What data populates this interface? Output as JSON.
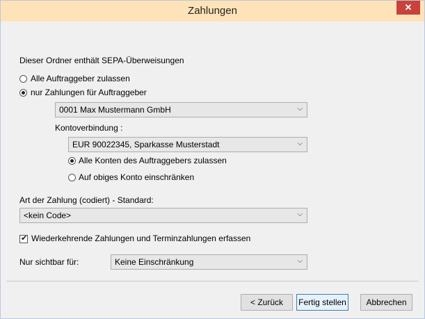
{
  "window": {
    "title": "Zahlungen",
    "close_glyph": "✕"
  },
  "intro_text": "Dieser Ordner enthält SEPA-Überweisungen",
  "auftraggeber": {
    "option_all": "Alle Auftraggeber zulassen",
    "option_only": "nur Zahlungen für Auftraggeber",
    "selected": "only",
    "combo_value": "0001 Max Mustermann GmbH"
  },
  "konto": {
    "label": "Kontoverbindung :",
    "combo_value": "EUR 90022345, Sparkasse Musterstadt",
    "option_all_accounts": "Alle Konten des Auftraggebers zulassen",
    "option_restrict": "Auf obiges Konto einschränken",
    "selected": "all_accounts"
  },
  "payment_type": {
    "label": "Art der Zahlung (codiert) - Standard:",
    "combo_value": "<kein Code>"
  },
  "recurring": {
    "label": "Wiederkehrende Zahlungen und Terminzahlungen erfassen",
    "checked": true
  },
  "visibility": {
    "label": "Nur sichtbar für:",
    "combo_value": "Keine Einschränkung"
  },
  "buttons": {
    "back": "< Zurück",
    "finish": "Fertig stellen",
    "cancel": "Abbrechen"
  },
  "icons": {
    "dropdown": "chevron-down-icon",
    "check": "check-icon"
  }
}
